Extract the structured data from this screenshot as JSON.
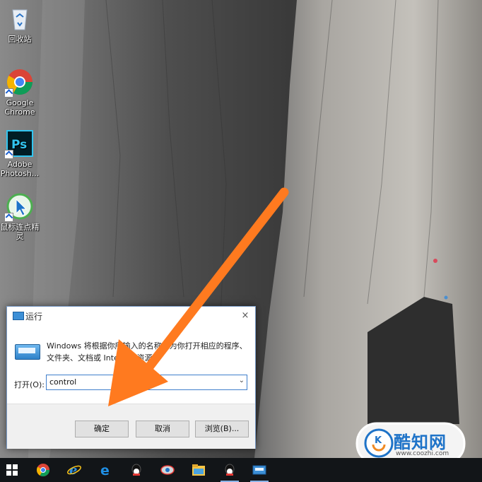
{
  "desktop": {
    "icons": [
      {
        "label": "回收站",
        "icon": "recycle-bin-icon"
      },
      {
        "label": "Google Chrome",
        "icon": "chrome-icon"
      },
      {
        "label": "Adobe Photosh...",
        "icon": "photoshop-icon"
      },
      {
        "label": "鼠标连点精灵",
        "icon": "mouse-clicker-icon"
      }
    ]
  },
  "dialog": {
    "title": "运行",
    "close_glyph": "×",
    "description": "Windows 将根据你所输入的名称，为你打开相应的程序、文件夹、文档或 Internet 资源。",
    "open_label": "打开(O):",
    "open_value": "control",
    "buttons": {
      "ok": "确定",
      "cancel": "取消",
      "browse": "浏览(B)..."
    }
  },
  "taskbar": {
    "items": [
      "windows-start-icon",
      "chrome-icon",
      "internet-explorer-icon",
      "edge-icon",
      "qq-icon",
      "tool-icon",
      "file-explorer-icon",
      "qq-icon",
      "run-icon"
    ]
  },
  "watermark": {
    "brand": "酷知网",
    "url": "www.coozhi.com"
  },
  "colors": {
    "arrow": "#ff7a1f",
    "taskbar": "#121518",
    "accent": "#1e73c8"
  }
}
